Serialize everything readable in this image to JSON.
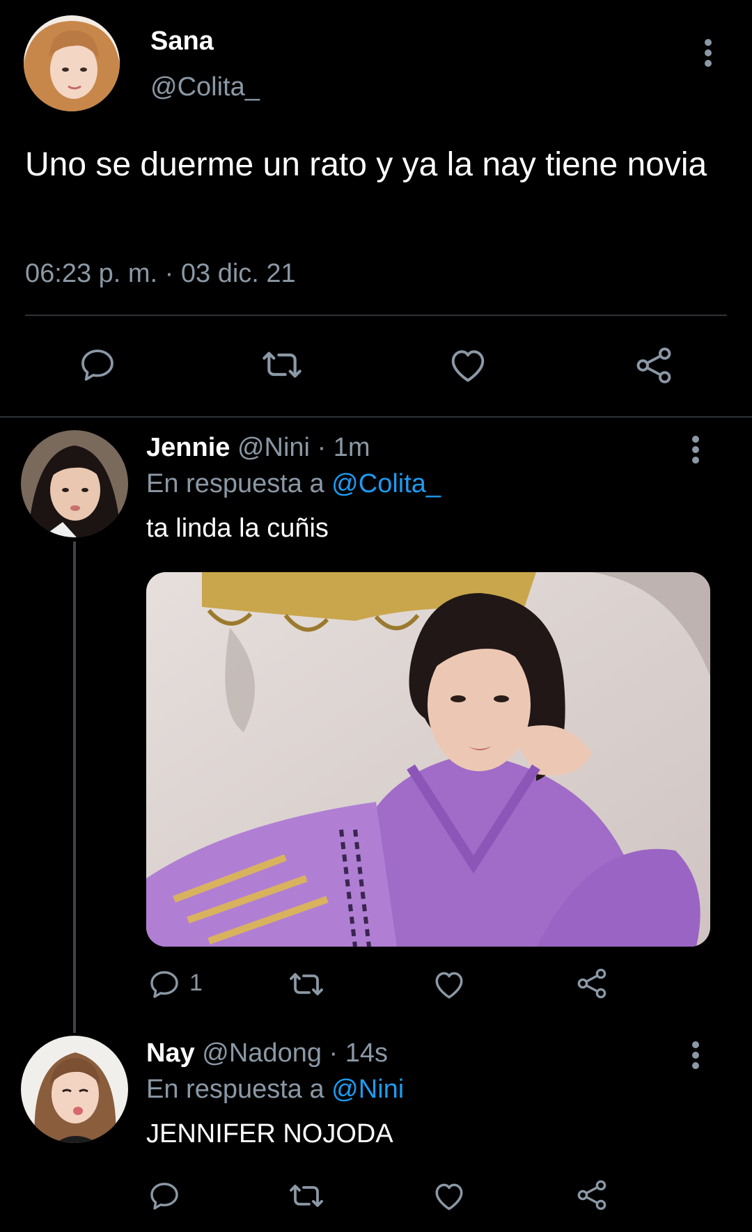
{
  "main_tweet": {
    "name": "Sana",
    "handle": "@Colita_",
    "text": "Uno se duerme un rato y ya la nay tiene novia",
    "timestamp": "06:23 p. m. · 03 dic. 21"
  },
  "replies": [
    {
      "name": "Jennie",
      "handle": "@Nini",
      "time": "· 1m",
      "reply_prefix": "En respuesta a",
      "reply_to": "@Colita_",
      "text": "ta linda la cuñis",
      "reply_count": "1"
    },
    {
      "name": "Nay",
      "handle": "@Nadong",
      "time": "· 14s",
      "reply_prefix": "En respuesta a",
      "reply_to": "@Nini",
      "text": "JENNIFER NOJODA",
      "reply_count": ""
    }
  ],
  "icons": {
    "reply": "reply-icon",
    "retweet": "retweet-icon",
    "like": "heart-icon",
    "share": "share-icon",
    "more": "more-options-icon"
  },
  "colors": {
    "background": "#000000",
    "text": "#ffffff",
    "muted": "#8b98a5",
    "link": "#1d9bf0",
    "divider": "#2f3336"
  }
}
